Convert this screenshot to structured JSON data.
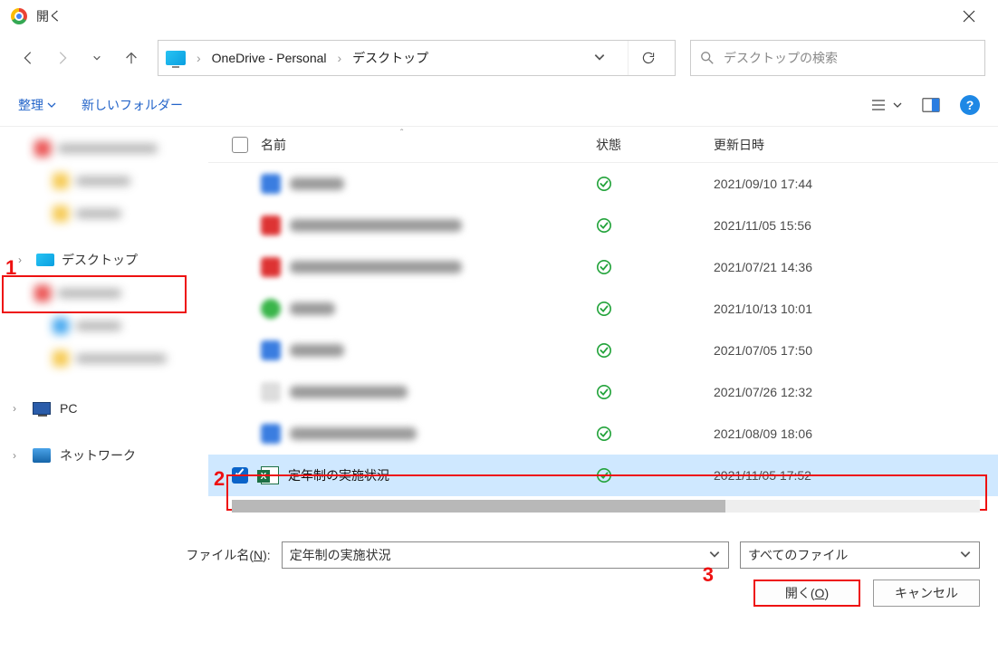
{
  "window": {
    "title": "開く"
  },
  "nav": {
    "breadcrumb": {
      "seg1": "OneDrive - Personal",
      "seg2": "デスクトップ"
    },
    "search_placeholder": "デスクトップの検索"
  },
  "toolbar": {
    "organize": "整理",
    "new_folder": "新しいフォルダー"
  },
  "sidebar": {
    "desktop_label": "デスクトップ",
    "pc_label": "PC",
    "network_label": "ネットワーク"
  },
  "columns": {
    "name": "名前",
    "status": "状態",
    "modified": "更新日時"
  },
  "files": [
    {
      "date": "2021/09/10 17:44"
    },
    {
      "date": "2021/11/05 15:56"
    },
    {
      "date": "2021/07/21 14:36"
    },
    {
      "date": "2021/10/13 10:01"
    },
    {
      "date": "2021/07/05 17:50"
    },
    {
      "date": "2021/07/26 12:32"
    },
    {
      "date": "2021/08/09 18:06"
    }
  ],
  "selected_file": {
    "name": "定年制の実施状況",
    "date": "2021/11/05 17:52"
  },
  "footer": {
    "filename_label": "ファイル名(N):",
    "filename_value": "定年制の実施状況",
    "filter_value": "すべてのファイル",
    "open_label": "開く(O)",
    "cancel_label": "キャンセル"
  },
  "annotations": {
    "n1": "1",
    "n2": "2",
    "n3": "3"
  }
}
